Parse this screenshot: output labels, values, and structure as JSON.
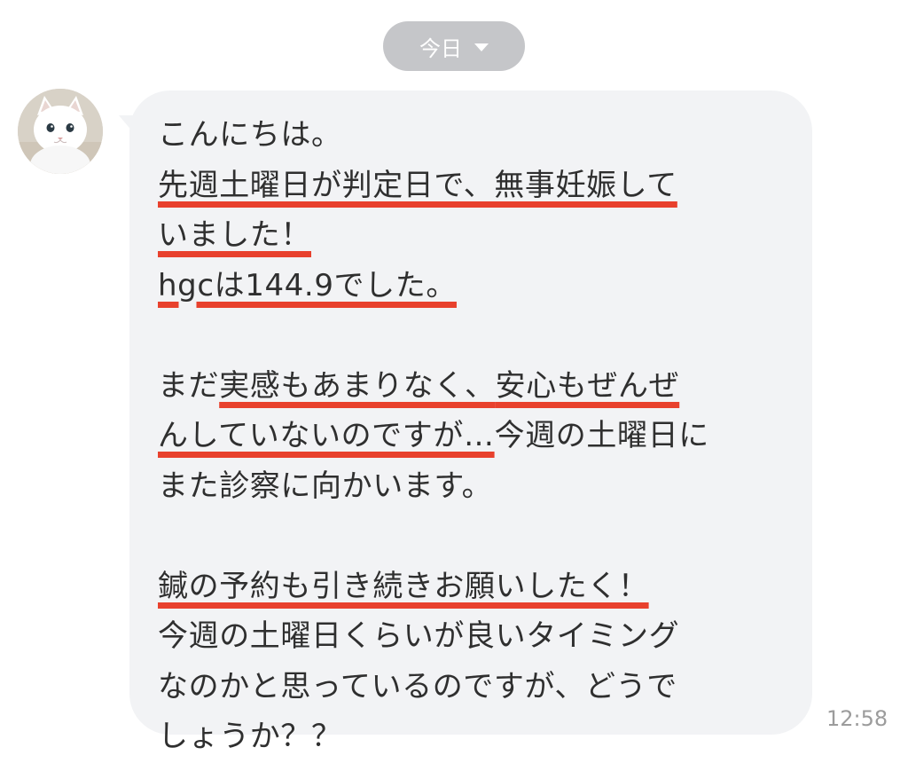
{
  "date_pill": {
    "label": "今日"
  },
  "message": {
    "lines": [
      [
        "こんにちは。"
      ],
      [
        {
          "t": "先週土曜日が判定日で、無事妊娠して",
          "u": true
        }
      ],
      [
        {
          "t": "いました！",
          "u": true
        }
      ],
      [
        {
          "t": "hgcは144.9でした。",
          "u": true
        }
      ],
      [],
      [
        "まだ",
        {
          "t": "実感もあまりなく、",
          "u": true
        },
        {
          "t": "安心もぜんぜ",
          "u": true
        }
      ],
      [
        {
          "t": "んしていないのですが…",
          "u": true
        },
        "今週の土曜日に"
      ],
      [
        "また診察に向かいます。"
      ],
      [],
      [
        {
          "t": "鍼の予約も引き続きお願いしたく！",
          "u": true
        }
      ],
      [
        "今週の土曜日くらいが良いタイミング"
      ],
      [
        "なのかと思っているのですが、どうで"
      ],
      [
        "しょうか？？"
      ]
    ],
    "time": "12:58"
  },
  "colors": {
    "bubble": "#f2f3f5",
    "underline": "#e8412d",
    "pill": "#c5c6c9",
    "text": "#2f2f2f",
    "time": "#9c9c9c"
  }
}
